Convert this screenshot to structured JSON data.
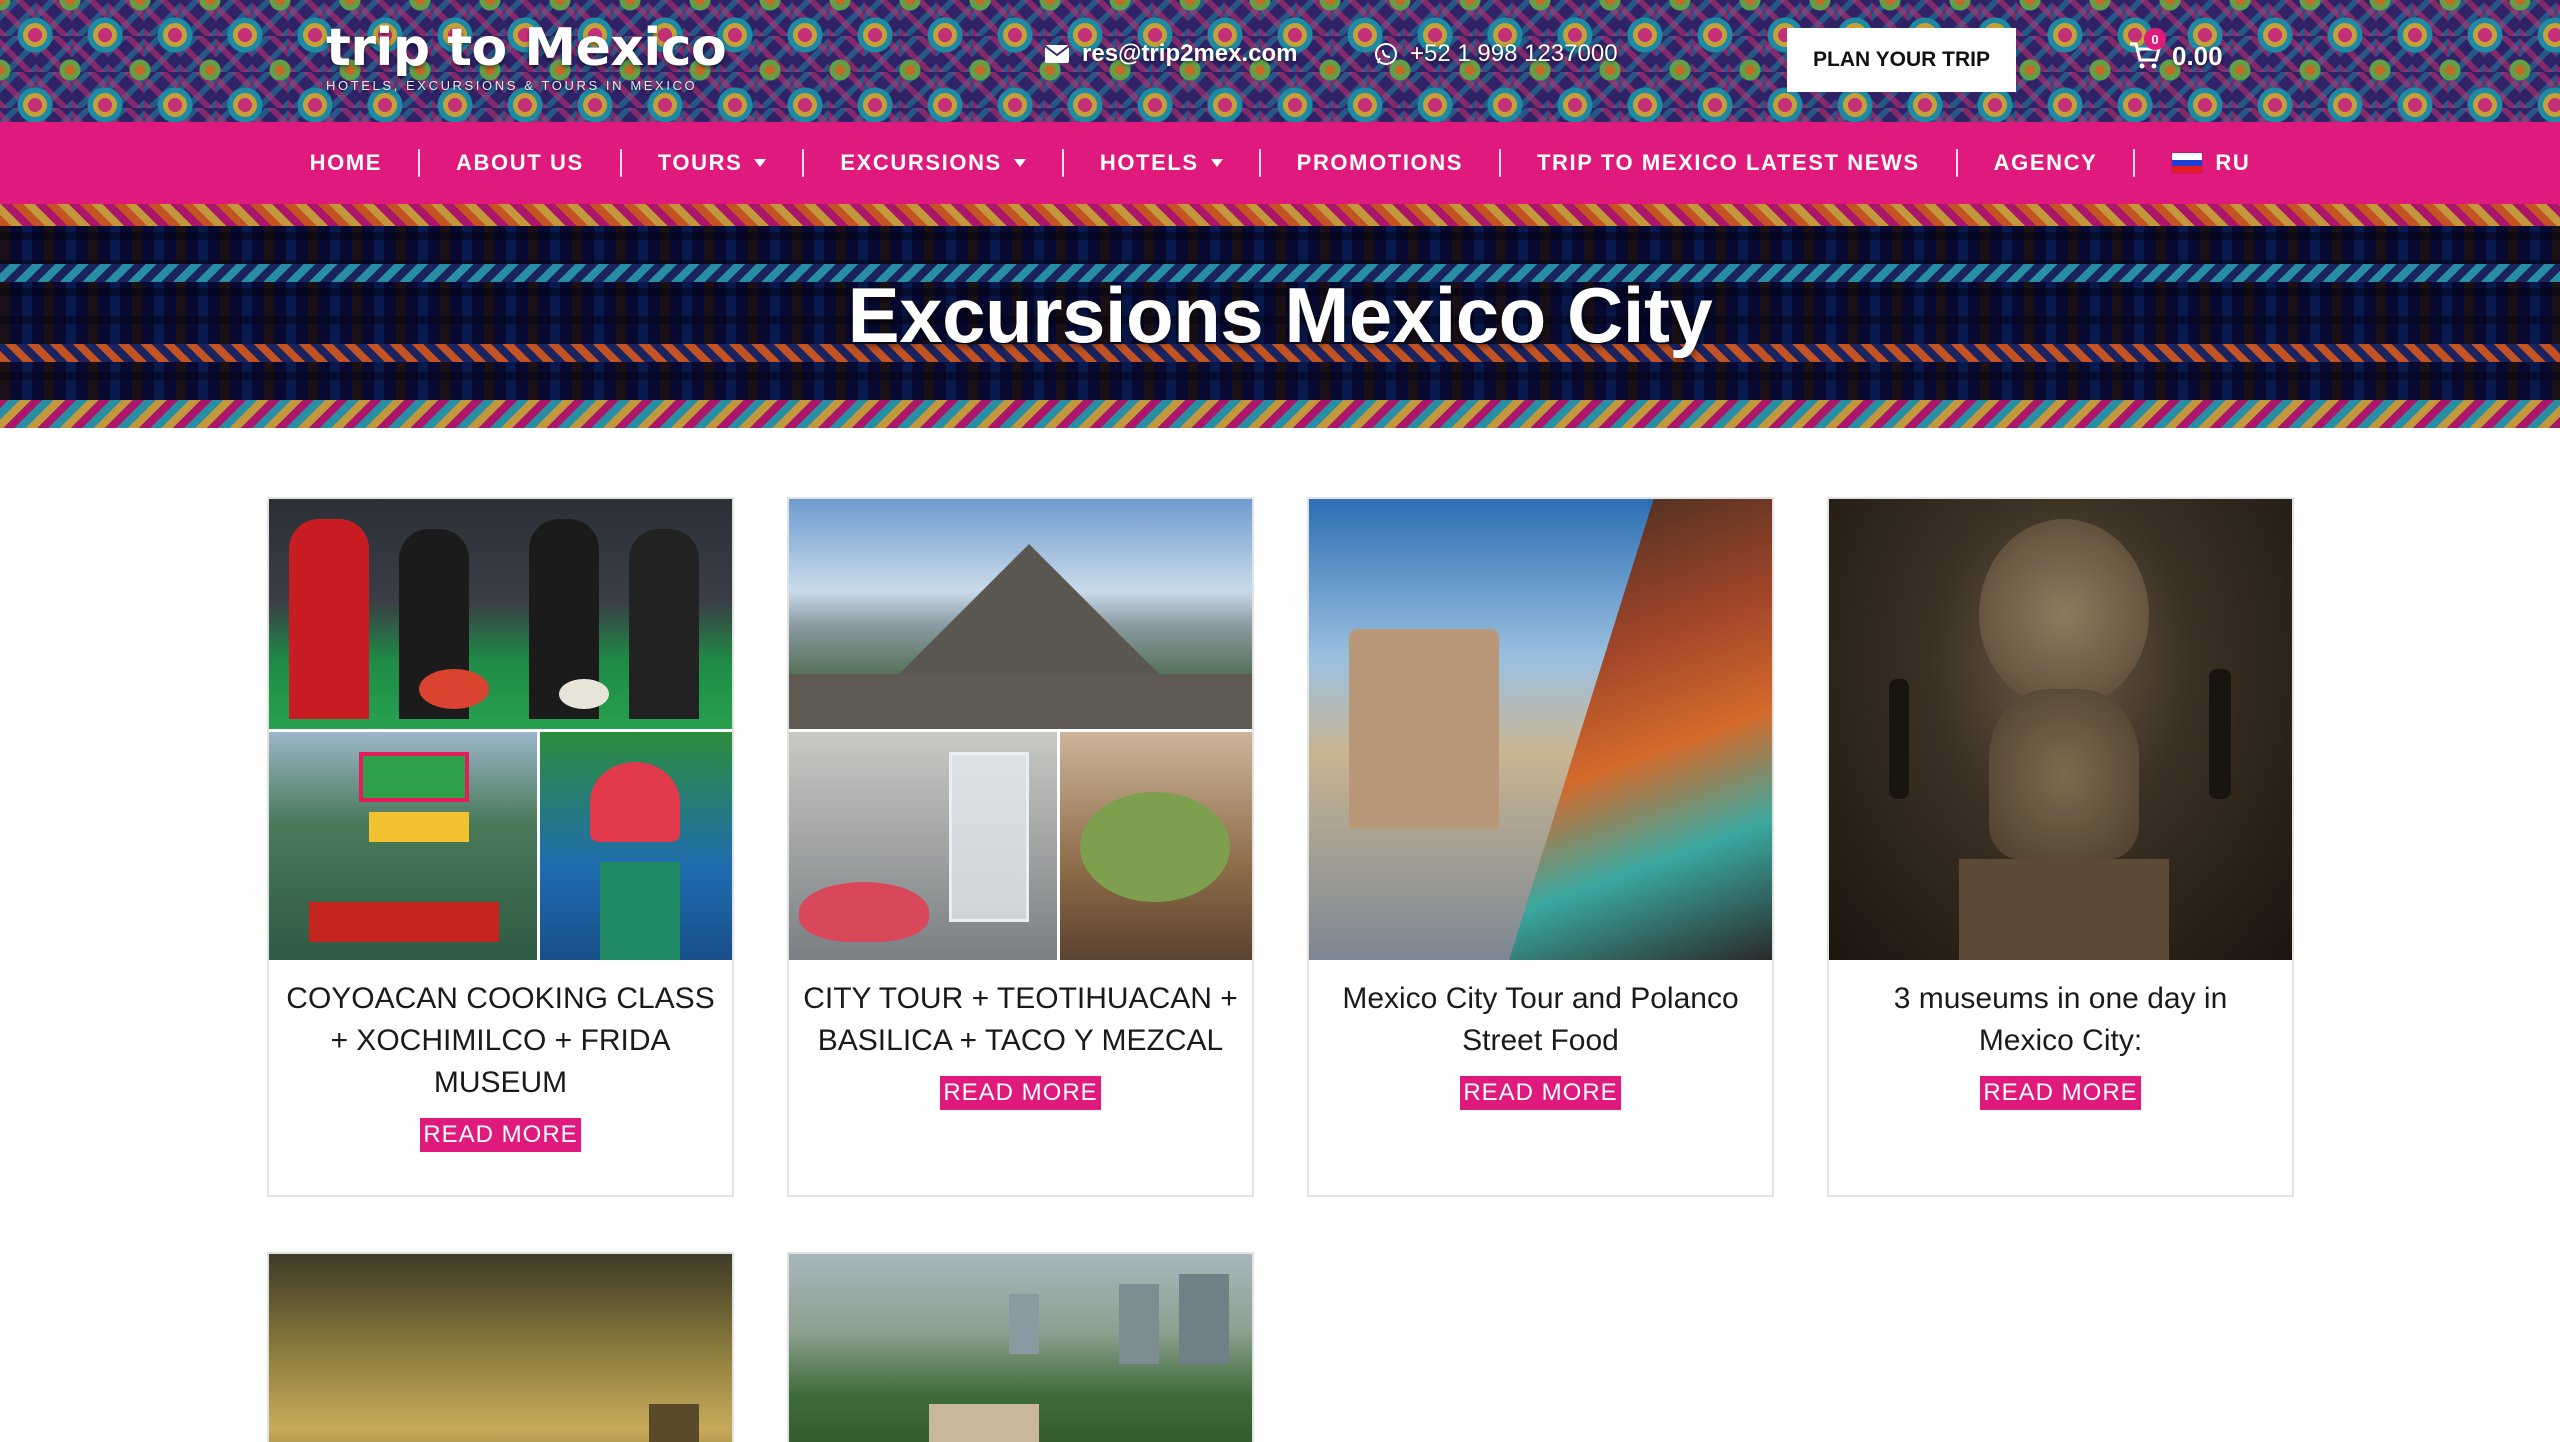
{
  "header": {
    "logo_text": "trip to Mexico",
    "logo_tagline": "HOTELS, EXCURSIONS & TOURS IN MEXICO",
    "email": "res@trip2mex.com",
    "phone": "+52 1 998 1237000",
    "plan_button": "PLAN YOUR TRIP",
    "cart_count": "0",
    "cart_total": "0.00"
  },
  "nav": {
    "items": [
      {
        "label": "HOME",
        "dropdown": false
      },
      {
        "label": "ABOUT US",
        "dropdown": false
      },
      {
        "label": "TOURS",
        "dropdown": true
      },
      {
        "label": "EXCURSIONS",
        "dropdown": true
      },
      {
        "label": "HOTELS",
        "dropdown": true
      },
      {
        "label": "PROMOTIONS",
        "dropdown": false
      },
      {
        "label": "TRIP TO MEXICO LATEST NEWS",
        "dropdown": false
      },
      {
        "label": "AGENCY",
        "dropdown": false
      }
    ],
    "language": "RU"
  },
  "hero": {
    "title": "Excursions Mexico City"
  },
  "cards": [
    {
      "title": "COYOACAN COOKING CLASS + XOCHIMILCO + FRIDA MUSEUM",
      "button": "READ MORE"
    },
    {
      "title": "CITY TOUR + TEOTIHUACAN + BASILICA + TACO Y MEZCAL",
      "button": "READ MORE"
    },
    {
      "title": "Mexico City Tour and Polanco Street Food",
      "button": "READ MORE"
    },
    {
      "title": "3 museums in one day in Mexico City:",
      "button": "READ MORE"
    }
  ],
  "colors": {
    "brand_pink": "#e0197d",
    "white": "#ffffff",
    "card_border": "#e2e2e2"
  }
}
